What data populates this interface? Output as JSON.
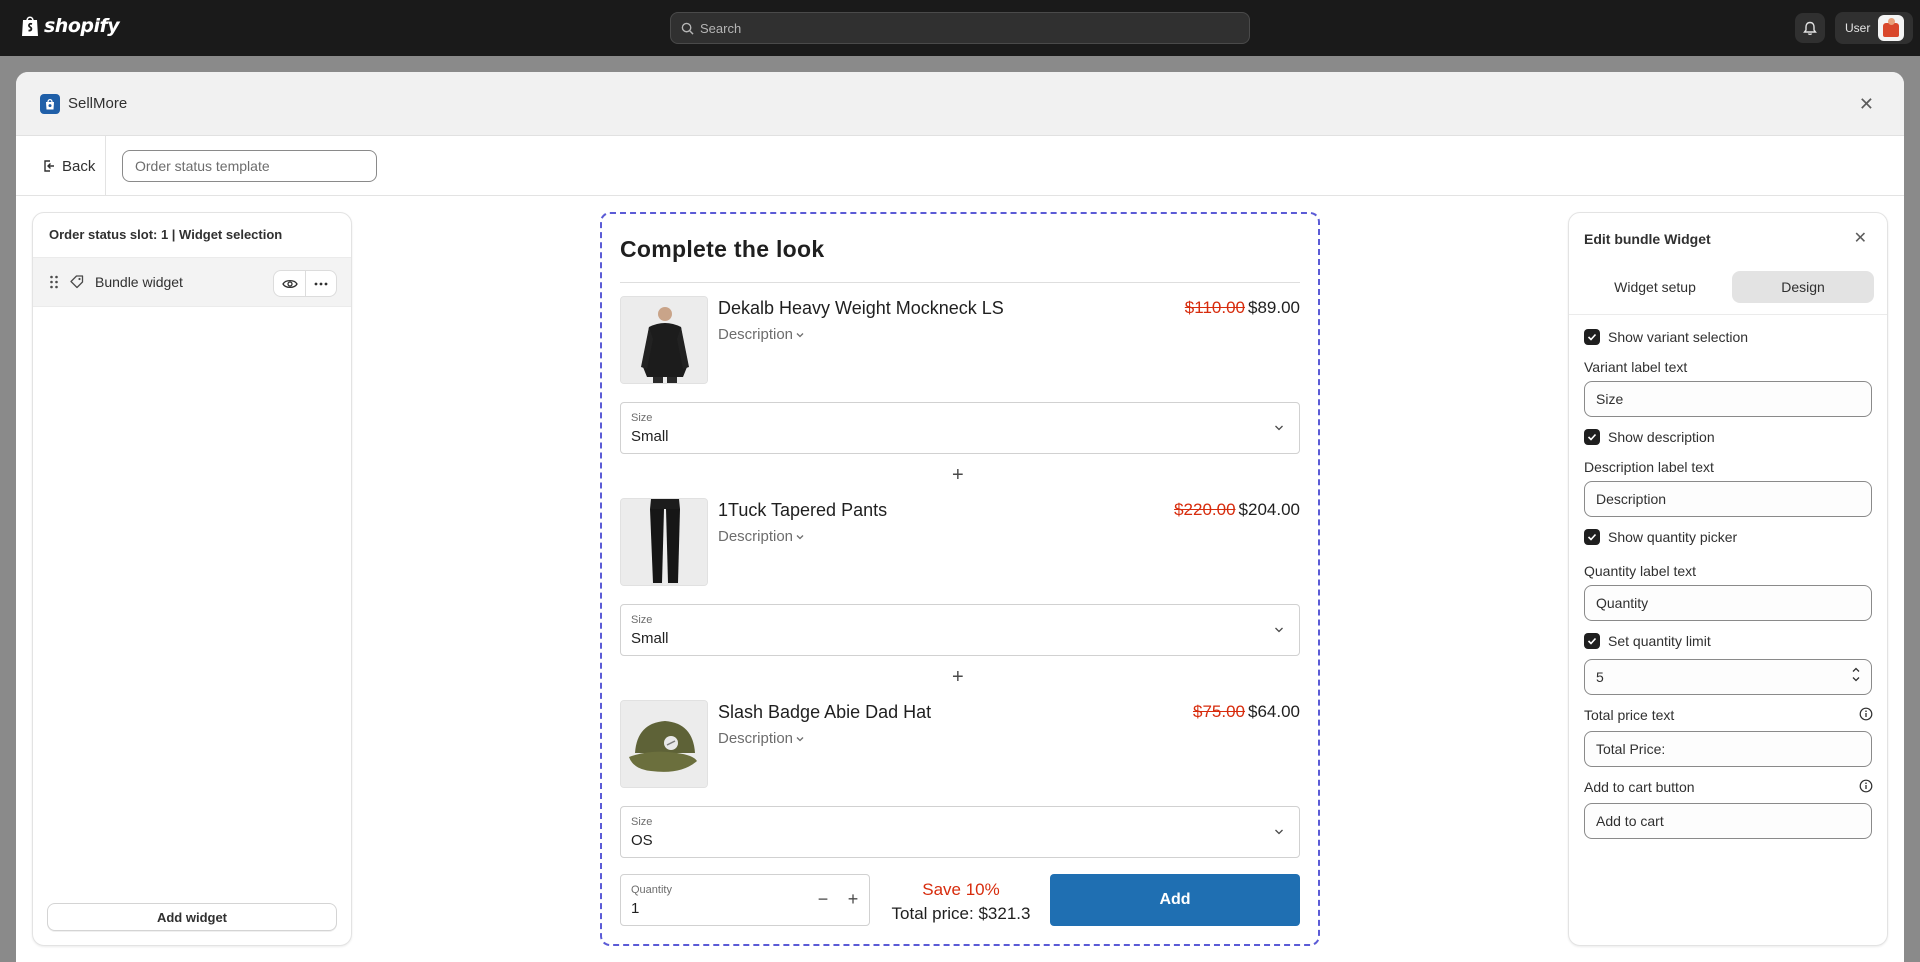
{
  "topbar": {
    "brand": "shopify",
    "search_placeholder": "Search",
    "user_label": "User"
  },
  "modal": {
    "app_name": "SellMore",
    "back_label": "Back",
    "template_placeholder": "Order status template"
  },
  "left_panel": {
    "title": "Order status slot: 1 | Widget selection",
    "widget_label": "Bundle widget",
    "add_widget_label": "Add widget"
  },
  "preview": {
    "title": "Complete the look",
    "products": [
      {
        "name": "Dekalb Heavy Weight Mockneck LS",
        "description_label": "Description",
        "old_price": "$110.00",
        "new_price": "$89.00",
        "size_label": "Size",
        "size_value": "Small"
      },
      {
        "name": "1Tuck Tapered Pants",
        "description_label": "Description",
        "old_price": "$220.00",
        "new_price": "$204.00",
        "size_label": "Size",
        "size_value": "Small"
      },
      {
        "name": "Slash Badge Abie Dad Hat",
        "description_label": "Description",
        "old_price": "$75.00",
        "new_price": "$64.00",
        "size_label": "Size",
        "size_value": "OS"
      }
    ],
    "quantity_label": "Quantity",
    "quantity_value": "1",
    "save_text": "Save 10%",
    "total_text": "Total price: $321.3",
    "add_label": "Add"
  },
  "right_panel": {
    "title": "Edit bundle Widget",
    "tabs": [
      "Widget setup",
      "Design"
    ],
    "show_variant_label": "Show variant selection",
    "variant_label_text": "Variant label text",
    "variant_value": "Size",
    "show_description_label": "Show description",
    "description_label_text": "Description label text",
    "description_value": "Description",
    "show_quantity_label": "Show quantity picker",
    "quantity_label_text": "Quantity label text",
    "quantity_value": "Quantity",
    "set_limit_label": "Set quantity limit",
    "limit_value": "5",
    "total_price_text_label": "Total price text",
    "total_price_value": "Total Price:",
    "add_to_cart_label": "Add to cart button",
    "add_to_cart_value": "Add to cart"
  },
  "colors": {
    "topbar": "#1a1a1a",
    "accent_blue": "#1f6fb2",
    "sale_red": "#d72c0d",
    "dashed_border": "#5b5bd6"
  }
}
